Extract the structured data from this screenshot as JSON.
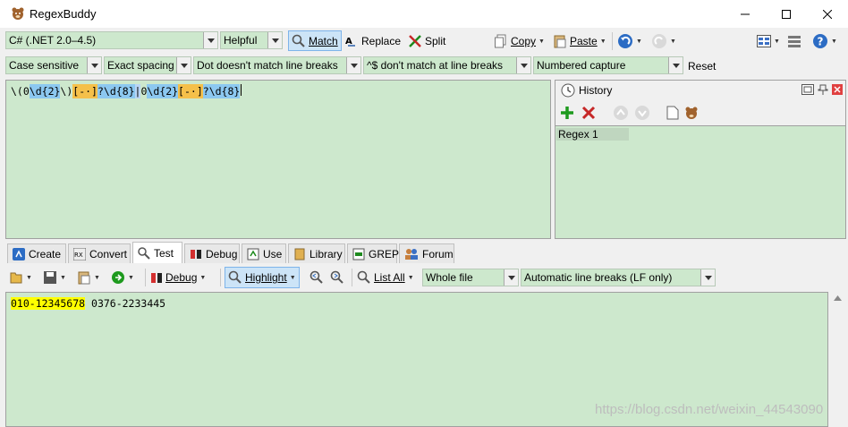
{
  "window": {
    "title": "RegexBuddy"
  },
  "toolbar1": {
    "flavor": "C# (.NET 2.0–4.5)",
    "helpful": "Helpful",
    "match_label": "Match",
    "replace_label": "Replace",
    "split_label": "Split",
    "copy_label": "Copy",
    "paste_label": "Paste"
  },
  "toolbar2": {
    "case": "Case sensitive",
    "spacing": "Exact spacing",
    "dot": "Dot doesn't match line breaks",
    "anchors": "^$ don't match at line breaks",
    "capture": "Numbered capture",
    "reset_label": "Reset"
  },
  "regex": {
    "tokens": [
      {
        "text": "\\(",
        "color": "#cde8cd"
      },
      {
        "text": "0",
        "color": "#cde8cd"
      },
      {
        "text": "\\d{2}",
        "color": "#8cc8f0"
      },
      {
        "text": "\\)",
        "color": "#cde8cd"
      },
      {
        "text": "[-·]",
        "color": "#f5c04a"
      },
      {
        "text": "?",
        "color": "#8cc8f0"
      },
      {
        "text": "\\d{8}",
        "color": "#8cc8f0"
      },
      {
        "text": "|",
        "color": "#b9d5f5"
      },
      {
        "text": "0",
        "color": "#cde8cd"
      },
      {
        "text": "\\d{2}",
        "color": "#8cc8f0"
      },
      {
        "text": "[-·]",
        "color": "#f5c04a"
      },
      {
        "text": "?",
        "color": "#8cc8f0"
      },
      {
        "text": "\\d{8}",
        "color": "#8cc8f0"
      }
    ]
  },
  "history": {
    "title": "History",
    "items": [
      "Regex 1"
    ]
  },
  "tabs": [
    "Create",
    "Convert",
    "Test",
    "Debug",
    "Use",
    "Library",
    "GREP",
    "Forum"
  ],
  "toolbar3": {
    "debug_label": "Debug",
    "highlight_label": "Highlight",
    "list_all_label": "List All",
    "scope": "Whole file",
    "line_breaks": "Automatic line breaks (LF only)"
  },
  "test": {
    "match_text": "010-12345678",
    "rest_text": " 0376-2233445"
  },
  "watermark": "https://blog.csdn.net/weixin_44543090",
  "colors": {
    "pane_bg": "#cde8cd",
    "match_highlight": "#ffff00",
    "accent": "#cce4f7"
  }
}
